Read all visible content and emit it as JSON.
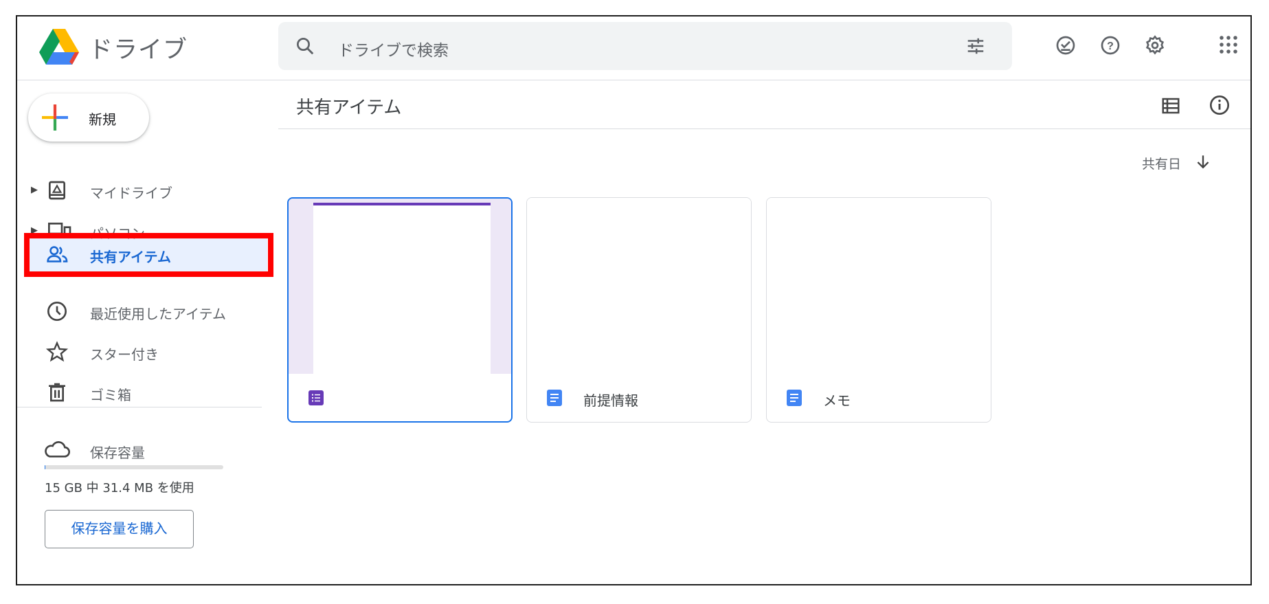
{
  "header": {
    "app_name": "ドライブ",
    "search_placeholder": "ドライブで検索"
  },
  "sidebar": {
    "new_label": "新規",
    "items": [
      {
        "label": "マイドライブ"
      },
      {
        "label": "パソコン"
      },
      {
        "label": "共有アイテム"
      },
      {
        "label": "最近使用したアイテム"
      },
      {
        "label": "スター付き"
      },
      {
        "label": "ゴミ箱"
      }
    ],
    "storage_label": "保存容量",
    "storage_usage_text": "15 GB 中 31.4 MB を使用",
    "storage_used_fraction": 0.002,
    "buy_storage_label": "保存容量を購入"
  },
  "main": {
    "title": "共有アイテム",
    "sort_label": "共有日",
    "files": [
      {
        "name": "",
        "type": "form"
      },
      {
        "name": "前提情報",
        "type": "doc"
      },
      {
        "name": "メモ",
        "type": "doc"
      }
    ]
  },
  "colors": {
    "accent": "#1967d2",
    "active_bg": "#e8f0fe",
    "highlight": "#ff0000",
    "form_purple": "#673ab7",
    "doc_blue": "#4285f4"
  }
}
